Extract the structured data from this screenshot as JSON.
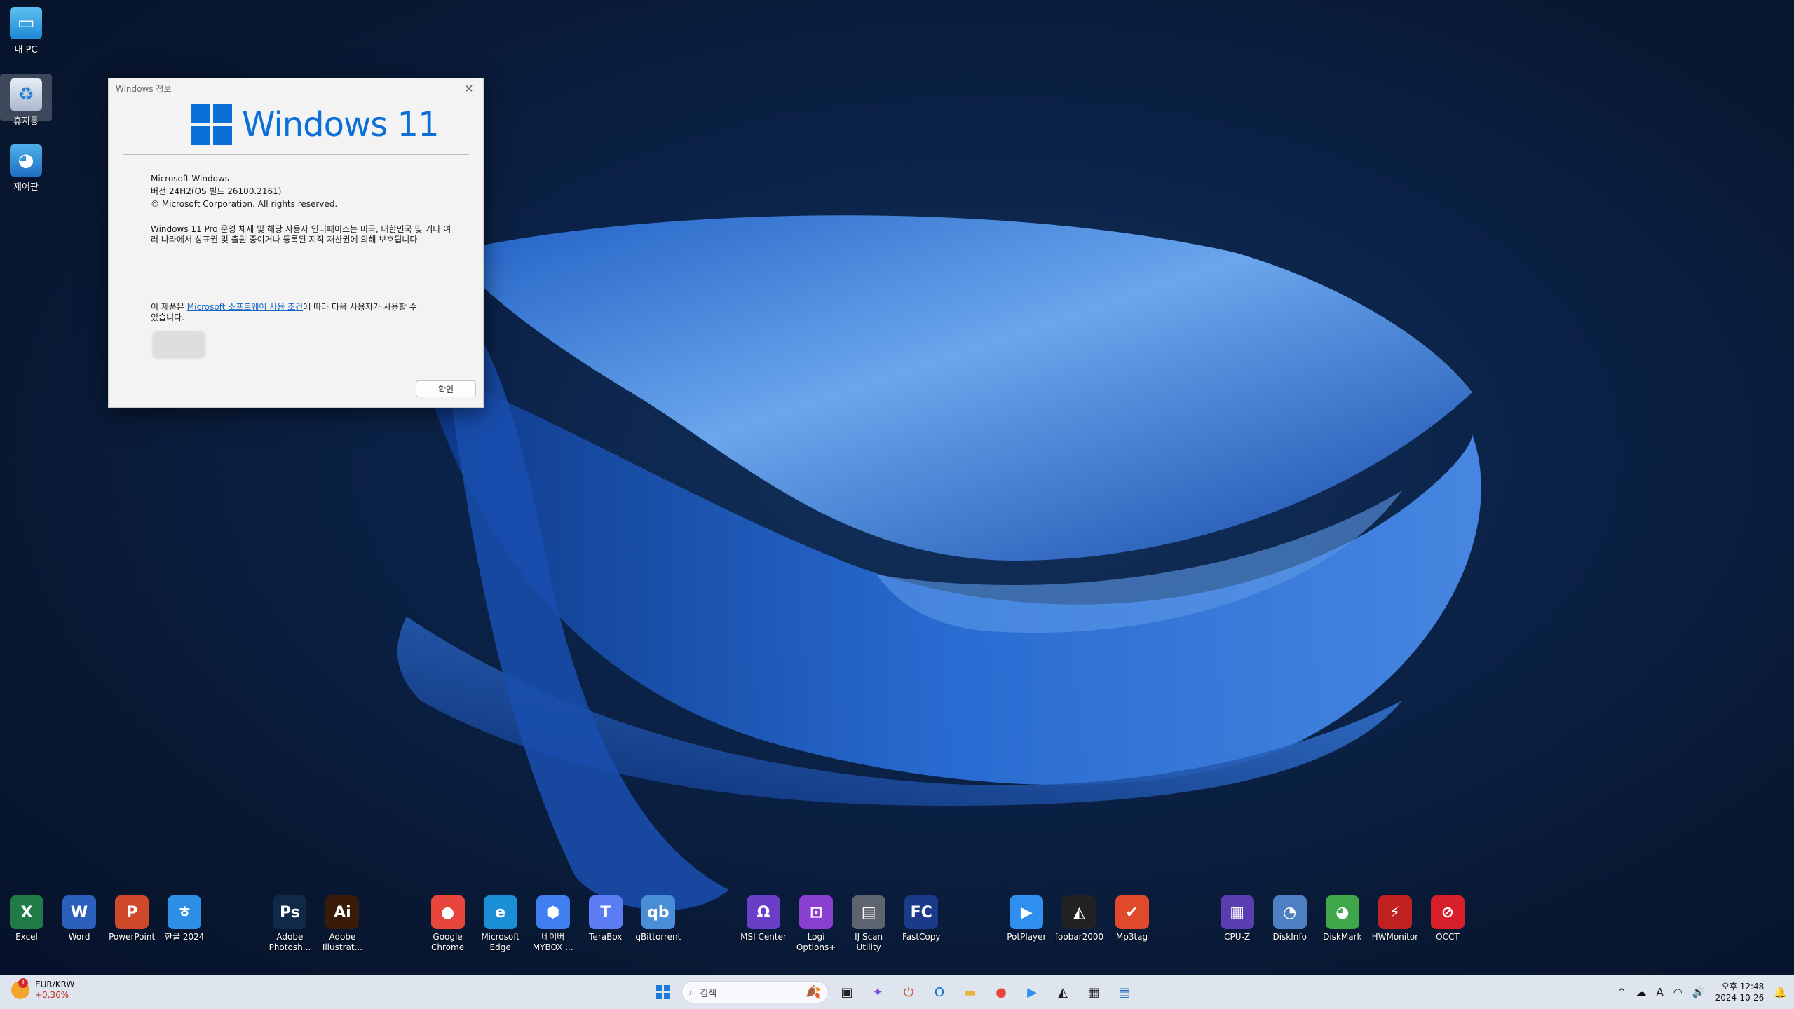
{
  "desktop": {
    "icons": [
      {
        "label": "내 PC",
        "icon": "monitor-icon"
      },
      {
        "label": "휴지통",
        "icon": "recycle-bin-icon"
      },
      {
        "label": "제어판",
        "icon": "control-panel-icon"
      }
    ]
  },
  "dialog": {
    "title": "Windows 정보",
    "logo_text": "Windows 11",
    "product": "Microsoft Windows",
    "version": "버전 24H2(OS 빌드 26100.2161)",
    "copyright": "© Microsoft Corporation. All rights reserved.",
    "legal": "Windows 11 Pro 운영 체제 및 해당 사용자 인터페이스는 미국, 대한민국 및 기타 여러 나라에서 상표권 및 출원 중이거나 등록된 지적 재산권에 의해 보호됩니다.",
    "license_prefix": "이 제품은 ",
    "license_link": "Microsoft 소프트웨어 사용 조건",
    "license_suffix": "에 따라 다음 사용자가 사용할 수 있습니다.",
    "ok_label": "확인",
    "accent": "#0a6fd6"
  },
  "shortcuts": [
    {
      "label": "Excel",
      "glyph": "X",
      "color": "#1f7a45",
      "icon": "excel-icon"
    },
    {
      "label": "Word",
      "glyph": "W",
      "color": "#2b5fbd",
      "icon": "word-icon"
    },
    {
      "label": "PowerPoint",
      "glyph": "P",
      "color": "#d0482a",
      "icon": "powerpoint-icon"
    },
    {
      "label": "한글 2024",
      "glyph": "ㅎ",
      "color": "#2d8fe6",
      "icon": "hangul-icon"
    },
    {
      "label": "Adobe\nPhotosh...",
      "glyph": "Ps",
      "color": "#0f2a48",
      "icon": "photoshop-icon"
    },
    {
      "label": "Adobe\nIllustrat...",
      "glyph": "Ai",
      "color": "#3a1a08",
      "icon": "illustrator-icon"
    },
    {
      "label": "Google\nChrome",
      "glyph": "●",
      "color": "#e8453c",
      "icon": "chrome-icon"
    },
    {
      "label": "Microsoft\nEdge",
      "glyph": "e",
      "color": "#1a8fd8",
      "icon": "edge-icon"
    },
    {
      "label": "네이버\nMYBOX ...",
      "glyph": "⬢",
      "color": "#3f7ff0",
      "icon": "mybox-icon"
    },
    {
      "label": "TeraBox",
      "glyph": "T",
      "color": "#5b7cf2",
      "icon": "terabox-icon"
    },
    {
      "label": "qBittorrent",
      "glyph": "qb",
      "color": "#4b8ed8",
      "icon": "qbittorrent-icon"
    },
    {
      "label": "MSI Center",
      "glyph": "Ω",
      "color": "#6a3fc8",
      "icon": "msi-center-icon"
    },
    {
      "label": "Logi\nOptions+",
      "glyph": "⊡",
      "color": "#8b3fd0",
      "icon": "logi-options-icon"
    },
    {
      "label": "IJ Scan\nUtility",
      "glyph": "▤",
      "color": "#5d6470",
      "icon": "scanner-icon"
    },
    {
      "label": "FastCopy",
      "glyph": "FC",
      "color": "#1c3a8a",
      "icon": "fastcopy-icon"
    },
    {
      "label": "PotPlayer",
      "glyph": "▶",
      "color": "#2f8ff0",
      "icon": "potplayer-icon"
    },
    {
      "label": "foobar2000",
      "glyph": "◭",
      "color": "#222222",
      "icon": "foobar-icon"
    },
    {
      "label": "Mp3tag",
      "glyph": "✔",
      "color": "#e04a2a",
      "icon": "mp3tag-icon"
    },
    {
      "label": "CPU-Z",
      "glyph": "▦",
      "color": "#5a3db0",
      "icon": "cpuz-icon"
    },
    {
      "label": "DiskInfo",
      "glyph": "◔",
      "color": "#4d7fc2",
      "icon": "diskinfo-icon"
    },
    {
      "label": "DiskMark",
      "glyph": "◕",
      "color": "#3fa64a",
      "icon": "diskmark-icon"
    },
    {
      "label": "HWMonitor",
      "glyph": "⚡",
      "color": "#c02020",
      "icon": "hwmonitor-icon"
    },
    {
      "label": "OCCT",
      "glyph": "⊘",
      "color": "#d8202a",
      "icon": "occt-icon"
    }
  ],
  "taskbar": {
    "widget_title": "EUR/KRW",
    "widget_change": "+0.36%",
    "widget_badge": "1",
    "search_placeholder": "검색",
    "pinned": [
      {
        "icon": "task-view-icon",
        "glyph": "▣",
        "color": "#222222"
      },
      {
        "icon": "copilot-icon",
        "glyph": "✦",
        "color": "#7a4fe0"
      },
      {
        "icon": "power-icon",
        "glyph": "⏻",
        "color": "#d0482a"
      },
      {
        "icon": "outlook-icon",
        "glyph": "O",
        "color": "#0a6fd6"
      },
      {
        "icon": "file-explorer-icon",
        "glyph": "▬",
        "color": "#e8b43a"
      },
      {
        "icon": "chrome-icon",
        "glyph": "●",
        "color": "#e8453c"
      },
      {
        "icon": "potplayer-icon",
        "glyph": "▶",
        "color": "#2f8ff0"
      },
      {
        "icon": "foobar-icon",
        "glyph": "◭",
        "color": "#222222"
      },
      {
        "icon": "calculator-icon",
        "glyph": "▦",
        "color": "#333333"
      },
      {
        "icon": "notepad-icon",
        "glyph": "▤",
        "color": "#1a66c5"
      }
    ],
    "clock_time": "오후 12:48",
    "clock_date": "2024-10-26"
  }
}
